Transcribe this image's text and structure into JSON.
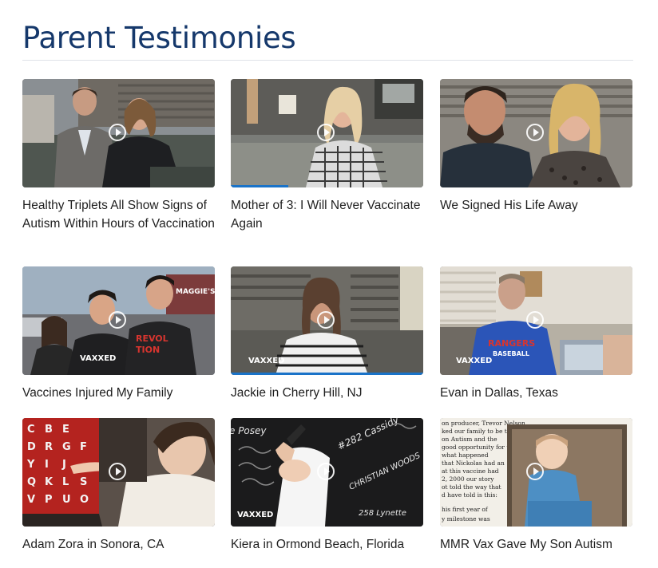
{
  "page_title": "Parent Testimonies",
  "cards": [
    {
      "title": "Healthy Triplets All Show Signs of Autism Within Hours of Vaccination"
    },
    {
      "title": "Mother of 3: I Will Never Vaccinate Again"
    },
    {
      "title": "We Signed His Life Away"
    },
    {
      "title": "Vaccines Injured My Family",
      "thumb_text": [
        "MAGGIE'S",
        "VAXXED",
        "REVOL",
        "TION"
      ]
    },
    {
      "title": "Jackie in Cherry Hill, NJ",
      "thumb_text": [
        "VAXXED"
      ]
    },
    {
      "title": "Evan in Dallas, Texas",
      "thumb_text": [
        "VAXXED",
        "RANGERS",
        "BASEBALL"
      ]
    },
    {
      "title": "Adam Zora in Sonora, CA",
      "thumb_text": [
        "C",
        "B",
        "E",
        "D",
        "R",
        "G",
        "F",
        "Y",
        "I",
        "J",
        "Q",
        "K",
        "L",
        "S",
        "V",
        "P",
        "U",
        "O"
      ]
    },
    {
      "title": "Kiera in Ormond Beach, Florida",
      "thumb_text": [
        "VAXXED",
        "e Posey",
        "#282 Cassidy",
        "CHRISTIAN WOODS",
        "258 Lynette"
      ]
    },
    {
      "title": "MMR Vax Gave My Son Autism",
      "thumb_text": [
        "on producer, Trevor Nelson,",
        "ked our family to be the",
        "on Autism and the",
        "good opportunity for us",
        "what happened",
        "that Nickolas had an",
        "at this vaccine had",
        "2, 2000 our story",
        "ot told the way that",
        "d have told is this:",
        "his first year of",
        "y milestone was"
      ]
    }
  ],
  "colors": {
    "title": "#15386b",
    "rule": "#dfe3e8",
    "progress": "#1a73c8"
  },
  "icons": {
    "play": "play-circle-icon"
  }
}
